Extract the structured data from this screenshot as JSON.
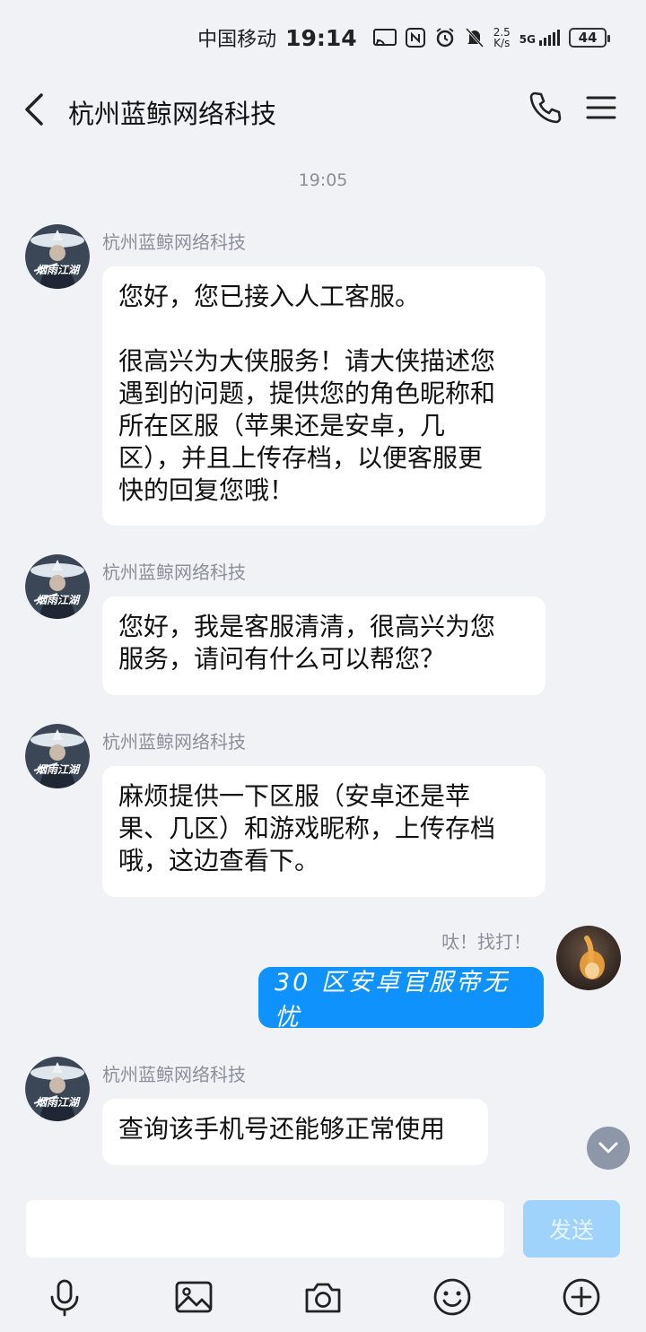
{
  "status_bar": {
    "carrier": "中国移动",
    "time": "19:14",
    "net_speed_value": "2.5",
    "net_speed_unit": "K/s",
    "network": "5G",
    "battery": "44"
  },
  "header": {
    "title": "杭州蓝鲸网络科技"
  },
  "chat": {
    "timestamp": "19:05",
    "messages": [
      {
        "sender": "杭州蓝鲸网络科技",
        "avatar_text": "烟雨江湖",
        "lines": [
          "您好，您已接入人工客服。"
        ],
        "lines2": [
          "很高兴为大侠服务！请大侠描述您",
          "遇到的问题，提供您的角色昵称和",
          "所在区服（苹果还是安卓，几",
          "区），并且上传存档，以便客服更",
          "快的回复您哦！"
        ]
      },
      {
        "sender": "杭州蓝鲸网络科技",
        "avatar_text": "烟雨江湖",
        "lines": [
          "您好，我是客服清清，很高兴为您",
          "服务，请问有什么可以帮您？"
        ]
      },
      {
        "sender": "杭州蓝鲸网络科技",
        "avatar_text": "烟雨江湖",
        "lines": [
          "麻烦提供一下区服（安卓还是苹",
          "果、几区）和游戏昵称，上传存档",
          "哦，这边查看下。"
        ]
      },
      {
        "sender": "呔！找打！",
        "text": "30 区安卓官服帝无忧",
        "self": true
      },
      {
        "sender": "杭州蓝鲸网络科技",
        "avatar_text": "烟雨江湖",
        "lines": [
          "查询该手机号还能够正常使用"
        ]
      }
    ]
  },
  "input": {
    "placeholder": "",
    "send_label": "发送"
  },
  "toolbar": [
    "microphone-icon",
    "image-icon",
    "camera-icon",
    "emoji-icon",
    "plus-circle-icon"
  ],
  "colors": {
    "background": "#f1f2f6",
    "self_bubble": "#0f92fb",
    "send_disabled": "#9fd3fb",
    "meta_text": "#8a8f99"
  }
}
